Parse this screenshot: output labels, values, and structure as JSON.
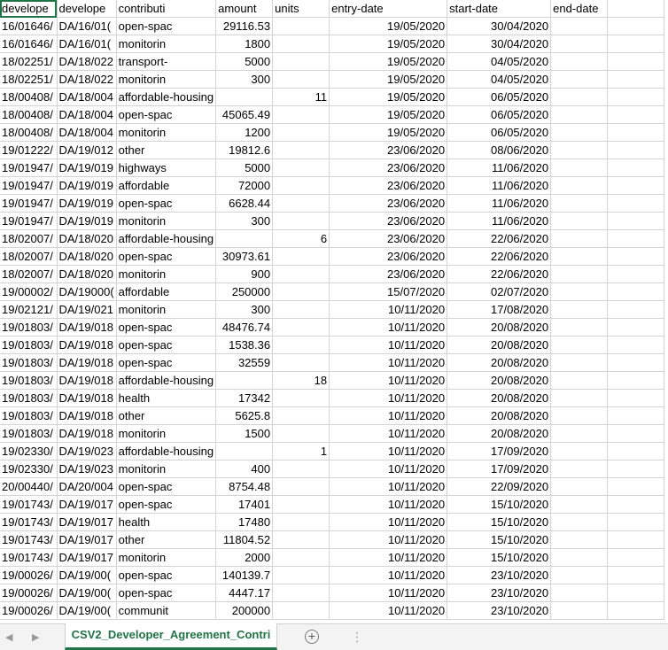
{
  "header": [
    "develope",
    "develope",
    "contributi",
    "amount",
    "units",
    "entry-date",
    "start-date",
    "end-date"
  ],
  "rows": [
    [
      "16/01646/",
      "DA/16/01(",
      "open-spac",
      "29116.53",
      "",
      "19/05/2020",
      "30/04/2020",
      ""
    ],
    [
      "16/01646/",
      "DA/16/01(",
      "monitorin",
      "1800",
      "",
      "19/05/2020",
      "30/04/2020",
      ""
    ],
    [
      "18/02251/",
      "DA/18/022",
      "transport-",
      "5000",
      "",
      "19/05/2020",
      "04/05/2020",
      ""
    ],
    [
      "18/02251/",
      "DA/18/022",
      "monitorin",
      "300",
      "",
      "19/05/2020",
      "04/05/2020",
      ""
    ],
    [
      "18/00408/",
      "DA/18/004",
      "affordable-housing",
      "",
      "11",
      "19/05/2020",
      "06/05/2020",
      ""
    ],
    [
      "18/00408/",
      "DA/18/004",
      "open-spac",
      "45065.49",
      "",
      "19/05/2020",
      "06/05/2020",
      ""
    ],
    [
      "18/00408/",
      "DA/18/004",
      "monitorin",
      "1200",
      "",
      "19/05/2020",
      "06/05/2020",
      ""
    ],
    [
      "19/01222/",
      "DA/19/012",
      "other",
      "19812.6",
      "",
      "23/06/2020",
      "08/06/2020",
      ""
    ],
    [
      "19/01947/",
      "DA/19/019",
      "highways",
      "5000",
      "",
      "23/06/2020",
      "11/06/2020",
      ""
    ],
    [
      "19/01947/",
      "DA/19/019",
      "affordable",
      "72000",
      "",
      "23/06/2020",
      "11/06/2020",
      ""
    ],
    [
      "19/01947/",
      "DA/19/019",
      "open-spac",
      "6628.44",
      "",
      "23/06/2020",
      "11/06/2020",
      ""
    ],
    [
      "19/01947/",
      "DA/19/019",
      "monitorin",
      "300",
      "",
      "23/06/2020",
      "11/06/2020",
      ""
    ],
    [
      "18/02007/",
      "DA/18/020",
      "affordable-housing",
      "",
      "6",
      "23/06/2020",
      "22/06/2020",
      ""
    ],
    [
      "18/02007/",
      "DA/18/020",
      "open-spac",
      "30973.61",
      "",
      "23/06/2020",
      "22/06/2020",
      ""
    ],
    [
      "18/02007/",
      "DA/18/020",
      "monitorin",
      "900",
      "",
      "23/06/2020",
      "22/06/2020",
      ""
    ],
    [
      "19/00002/",
      "DA/19000(",
      "affordable",
      "250000",
      "",
      "15/07/2020",
      "02/07/2020",
      ""
    ],
    [
      "19/02121/",
      "DA/19/021",
      "monitorin",
      "300",
      "",
      "10/11/2020",
      "17/08/2020",
      ""
    ],
    [
      "19/01803/",
      "DA/19/018",
      "open-spac",
      "48476.74",
      "",
      "10/11/2020",
      "20/08/2020",
      ""
    ],
    [
      "19/01803/",
      "DA/19/018",
      "open-spac",
      "1538.36",
      "",
      "10/11/2020",
      "20/08/2020",
      ""
    ],
    [
      "19/01803/",
      "DA/19/018",
      "open-spac",
      "32559",
      "",
      "10/11/2020",
      "20/08/2020",
      ""
    ],
    [
      "19/01803/",
      "DA/19/018",
      "affordable-housing",
      "",
      "18",
      "10/11/2020",
      "20/08/2020",
      ""
    ],
    [
      "19/01803/",
      "DA/19/018",
      "health",
      "17342",
      "",
      "10/11/2020",
      "20/08/2020",
      ""
    ],
    [
      "19/01803/",
      "DA/19/018",
      "other",
      "5625.8",
      "",
      "10/11/2020",
      "20/08/2020",
      ""
    ],
    [
      "19/01803/",
      "DA/19/018",
      "monitorin",
      "1500",
      "",
      "10/11/2020",
      "20/08/2020",
      ""
    ],
    [
      "19/02330/",
      "DA/19/023",
      "affordable-housing",
      "",
      "1",
      "10/11/2020",
      "17/09/2020",
      ""
    ],
    [
      "19/02330/",
      "DA/19/023",
      "monitorin",
      "400",
      "",
      "10/11/2020",
      "17/09/2020",
      ""
    ],
    [
      "20/00440/",
      "DA/20/004",
      "open-spac",
      "8754.48",
      "",
      "10/11/2020",
      "22/09/2020",
      ""
    ],
    [
      "19/01743/",
      "DA/19/017",
      "open-spac",
      "17401",
      "",
      "10/11/2020",
      "15/10/2020",
      ""
    ],
    [
      "19/01743/",
      "DA/19/017",
      "health",
      "17480",
      "",
      "10/11/2020",
      "15/10/2020",
      ""
    ],
    [
      "19/01743/",
      "DA/19/017",
      "other",
      "11804.52",
      "",
      "10/11/2020",
      "15/10/2020",
      ""
    ],
    [
      "19/01743/",
      "DA/19/017",
      "monitorin",
      "2000",
      "",
      "10/11/2020",
      "15/10/2020",
      ""
    ],
    [
      "19/00026/",
      "DA/19/00(",
      "open-spac",
      "140139.7",
      "",
      "10/11/2020",
      "23/10/2020",
      ""
    ],
    [
      "19/00026/",
      "DA/19/00(",
      "open-spac",
      "4447.17",
      "",
      "10/11/2020",
      "23/10/2020",
      ""
    ],
    [
      "19/00026/",
      "DA/19/00(",
      "communit",
      "200000",
      "",
      "10/11/2020",
      "23/10/2020",
      ""
    ]
  ],
  "numeric_columns": [
    3,
    4,
    5,
    6
  ],
  "tabs": {
    "sheet_name": "CSV2_Developer_Agreement_Contri",
    "add_sheet": "+",
    "nav_prev": "◀",
    "nav_next": "▶",
    "more": "⋮"
  }
}
